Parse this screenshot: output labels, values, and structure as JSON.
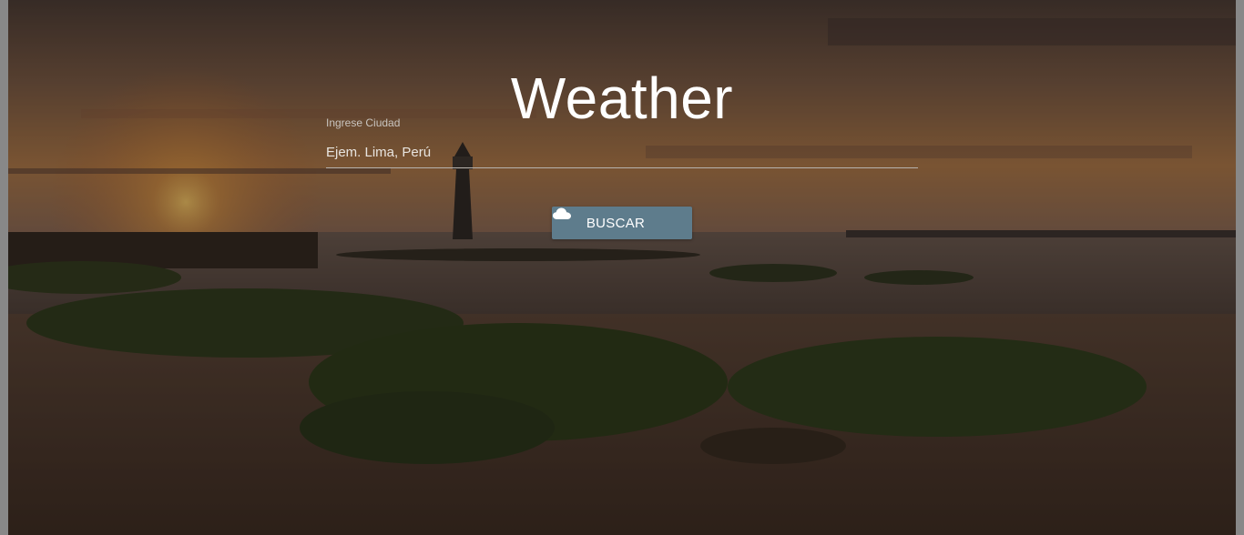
{
  "page": {
    "title": "Weather"
  },
  "search": {
    "label": "Ingrese Ciudad",
    "placeholder": "Ejem. Lima, Perú",
    "value": ""
  },
  "actions": {
    "search_label": "BUSCAR",
    "search_icon": "cloud-icon"
  },
  "colors": {
    "button": "#5e7c8c",
    "title": "#ffffff"
  }
}
